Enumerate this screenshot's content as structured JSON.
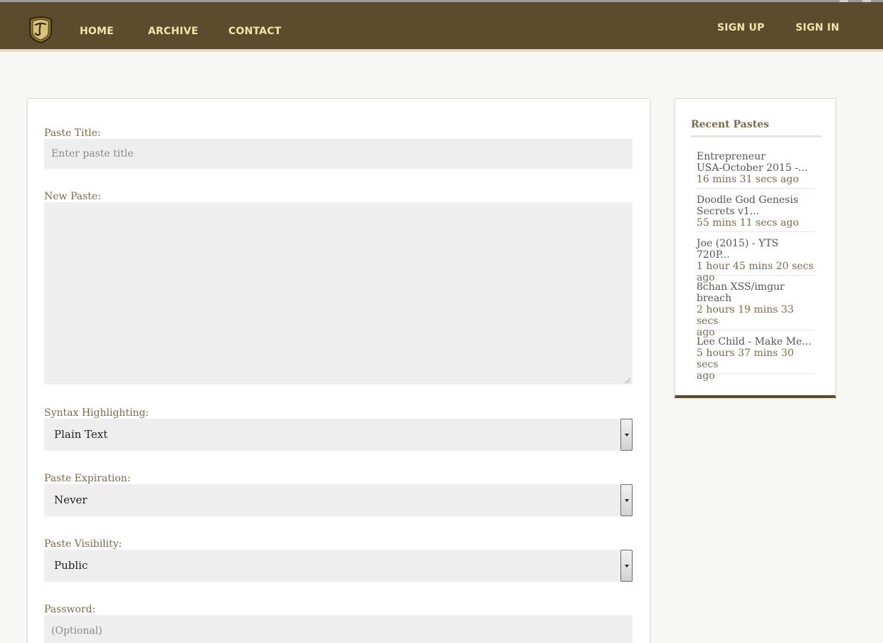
{
  "nav": {
    "home": "HOME",
    "archive": "ARCHIVE",
    "contact": "CONTACT",
    "sign_up": "SIGN UP",
    "sign_in": "SIGN IN"
  },
  "colors": {
    "navbar": "#5c4b2d",
    "nav_text": "#f4e4a8",
    "label_text": "#7a6a4a",
    "field_bg": "#eeeeee"
  },
  "form": {
    "title_label": "Paste Title:",
    "title_placeholder": "Enter paste title",
    "paste_label": "New Paste:",
    "syntax_label": "Syntax Highlighting:",
    "syntax_value": "Plain Text",
    "expiration_label": "Paste Expiration:",
    "expiration_value": "Never",
    "visibility_label": "Paste Visibility:",
    "visibility_value": "Public",
    "password_label": "Password:",
    "password_placeholder": "(Optional)"
  },
  "sidebar": {
    "title": "Recent Pastes",
    "items": [
      {
        "title_line1": "Entrepreneur",
        "title_line2": "USA-October 2015 -...",
        "time": "16 mins 31 secs ago"
      },
      {
        "title_line1": "Doodle God Genesis",
        "title_line2": "Secrets v1...",
        "time": "55 mins 11 secs ago"
      },
      {
        "title_line1": "Joe (2015) - YTS 720P...",
        "time_line1": "1 hour 45 mins 20 secs",
        "time_line2": "ago"
      },
      {
        "title_line1": "8chan XSS/imgur",
        "title_line2": "breach",
        "time_line1": "2 hours 19 mins 33 secs",
        "time_line2": "ago"
      },
      {
        "title_line1": "Lee Child - Make Me...",
        "time_line1": "5 hours 37 mins 30 secs",
        "time_line2": "ago"
      }
    ]
  }
}
